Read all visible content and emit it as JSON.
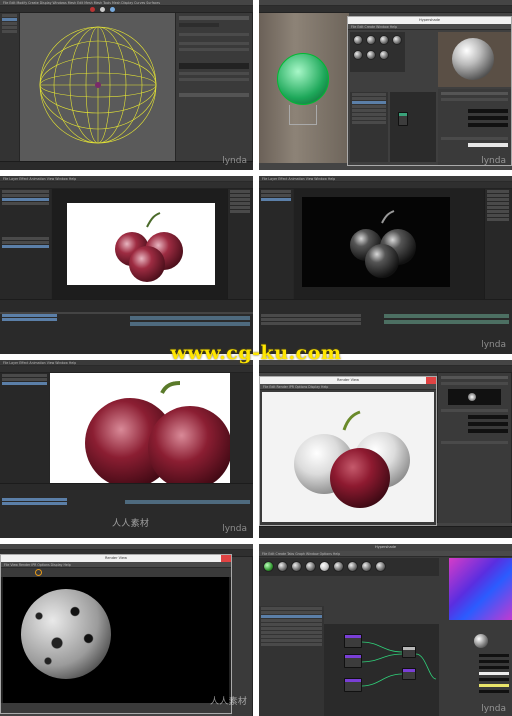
{
  "watermark": {
    "center": "www.cg-ku.com",
    "lynda": "lynda",
    "cn": "人人素材"
  },
  "panels": [
    {
      "id": "maya-wireframe-sphere",
      "menu": "File  Edit  Modify  Create  Display  Windows  Mesh  Edit Mesh  Mesh Tools  Mesh Display  Curves  Surfaces"
    },
    {
      "id": "hypershade-material-editor",
      "dialog_title": "Hypershade",
      "menu": "File  Edit  Create  Window  Help"
    },
    {
      "id": "nuke-grape-color",
      "menu": "File  Layer  Effect  Animation  View  Window  Help"
    },
    {
      "id": "ae-grape-bw",
      "menu": "File  Layer  Effect  Animation  View  Window  Help"
    },
    {
      "id": "grape-closeup-red",
      "menu": "File  Layer  Effect  Animation  View  Window  Help"
    },
    {
      "id": "render-view-grapes",
      "dialog_title": "Render View",
      "menu": "File  Edit  Render  IPR  Options  Display  Help"
    },
    {
      "id": "render-view-granite-sphere",
      "dialog_title": "Render View",
      "menu": "File  View  Render  IPR  Options  Display  Help"
    },
    {
      "id": "hypershade-node-graph",
      "dialog_title": "Hypershade",
      "menu": "File  Edit  Create  Tabs  Graph  Window  Options  Help"
    }
  ]
}
